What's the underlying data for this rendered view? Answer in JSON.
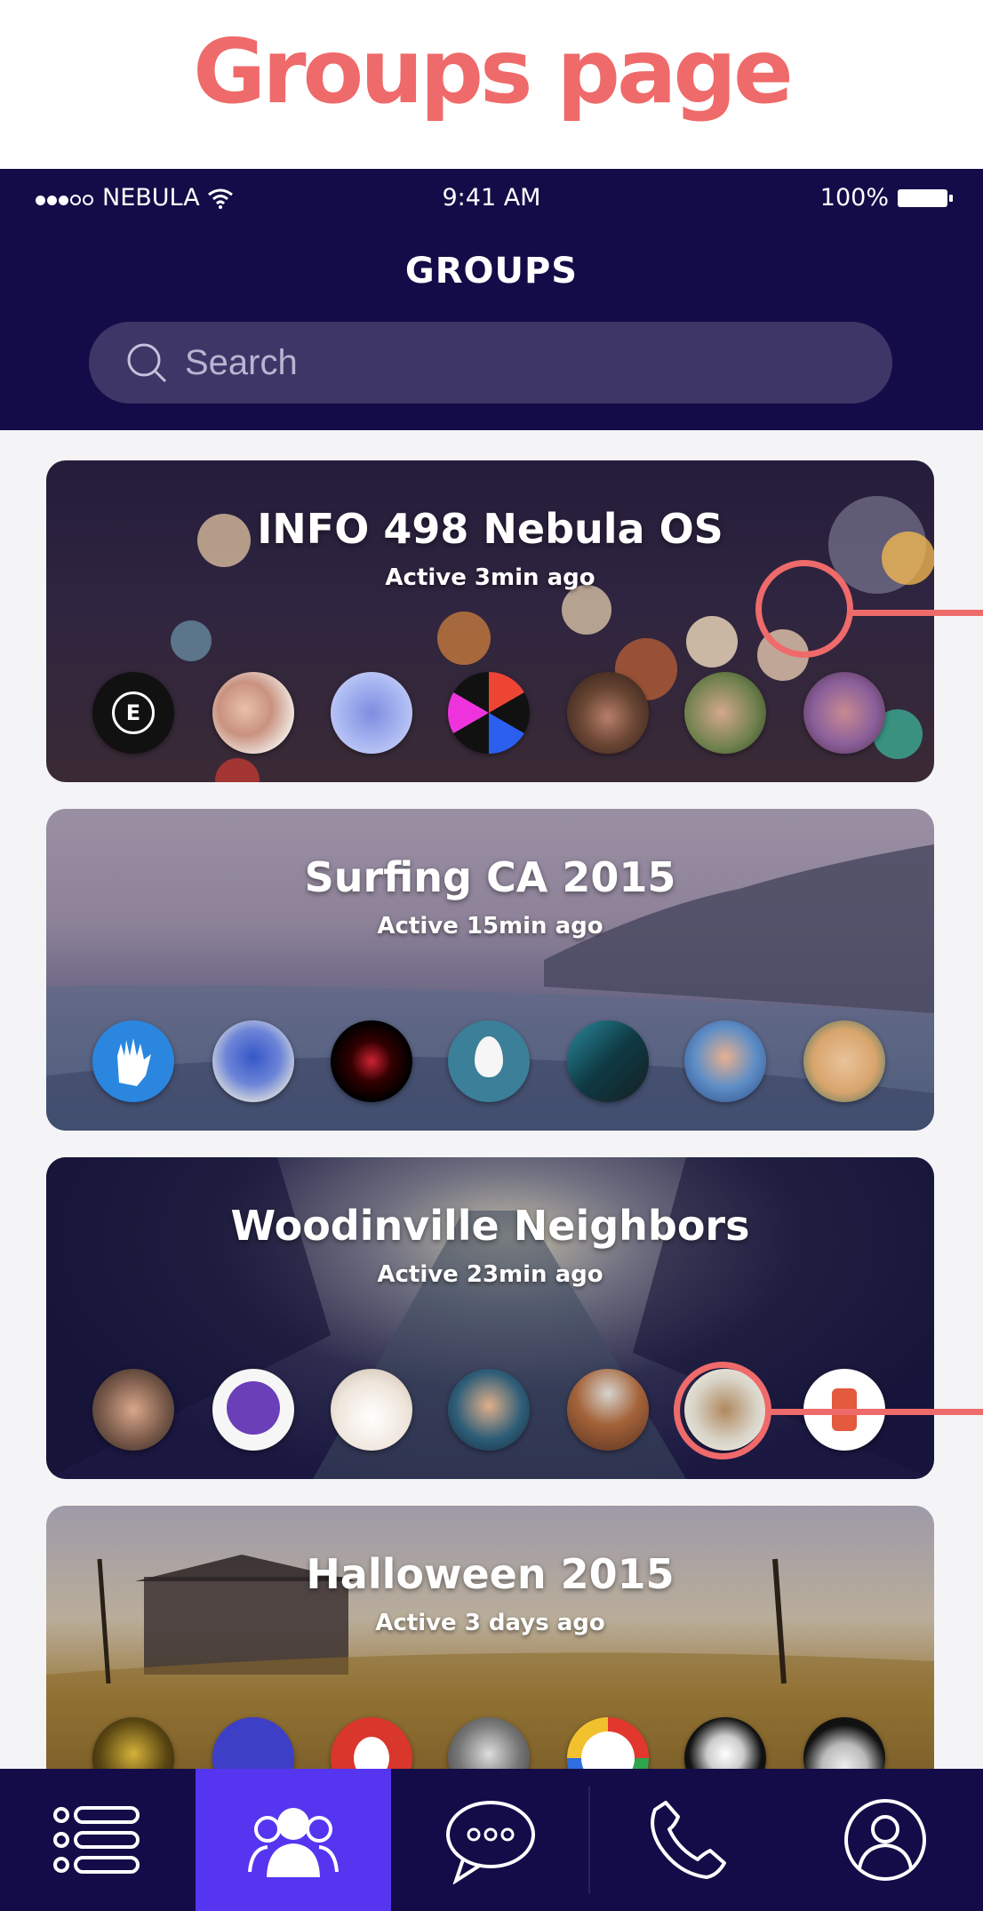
{
  "page_heading": "Groups page",
  "status_bar": {
    "carrier": "NEBULA",
    "time": "9:41 AM",
    "battery": "100%"
  },
  "header": {
    "title": "GROUPS"
  },
  "search": {
    "placeholder": "Search"
  },
  "groups": [
    {
      "name": "INFO 498 Nebula OS",
      "activity": "Active 3min ago"
    },
    {
      "name": "Surfing CA 2015",
      "activity": "Active 15min ago"
    },
    {
      "name": "Woodinville Neighbors",
      "activity": "Active 23min ago"
    },
    {
      "name": "Halloween 2015",
      "activity": "Active 3 days ago"
    }
  ],
  "avatar_label_1_2": "E",
  "tabs": [
    "menu",
    "groups",
    "messages",
    "calls",
    "profile"
  ],
  "icons": [
    "wifi-icon",
    "battery-icon",
    "search-icon",
    "menu-list-icon",
    "groups-icon",
    "chat-bubble-icon",
    "phone-icon",
    "profile-icon"
  ],
  "colors": {
    "header_bg": "#130c48",
    "accent": "#5535ef",
    "annotation": "#ef6a6a",
    "search_bg": "#3e3666"
  }
}
